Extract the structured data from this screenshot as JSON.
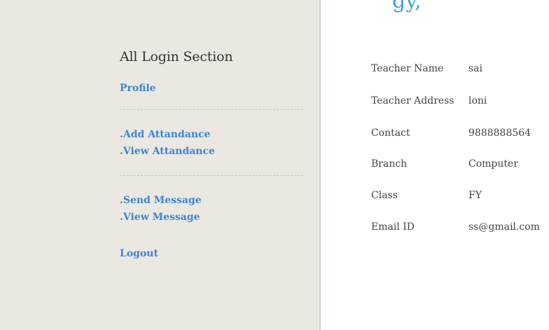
{
  "header": {
    "partial_title": "gy,"
  },
  "sidebar": {
    "title": "All Login Section",
    "profile": "Profile",
    "add_attendance": ".Add Attandance",
    "view_attendance": ".View Attandance",
    "send_message": ".Send Message",
    "view_message": ".View Message",
    "logout": "Logout"
  },
  "details": [
    {
      "label": "Teacher Name",
      "value": "sai"
    },
    {
      "label": "Teacher Address",
      "value": "loni"
    },
    {
      "label": "Contact",
      "value": "9888888564"
    },
    {
      "label": "Branch",
      "value": "Computer"
    },
    {
      "label": "Class",
      "value": "FY"
    },
    {
      "label": "Email ID",
      "value": "ss@gmail.com"
    }
  ],
  "colors": {
    "sidebar_bg": "#ebe8e1",
    "link": "#3c86d2",
    "text": "#444444"
  }
}
